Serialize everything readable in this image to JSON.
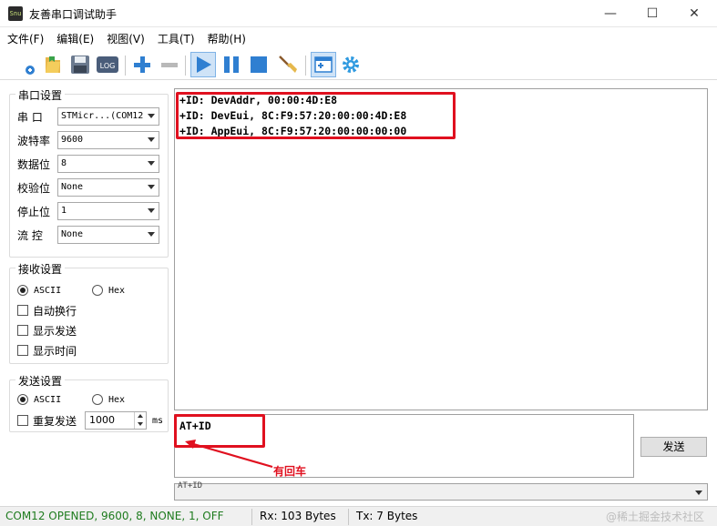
{
  "window": {
    "title": "友善串口调试助手",
    "app_icon_text": "Snu",
    "min": "—",
    "max": "☐",
    "close": "✕"
  },
  "menu": [
    "文件(F)",
    "编辑(E)",
    "视图(V)",
    "工具(T)",
    "帮助(H)"
  ],
  "toolbar": {
    "icons": [
      "new-icon",
      "open-icon",
      "save-icon",
      "log-icon",
      "add-icon",
      "remove-icon",
      "play-icon",
      "pause-icon",
      "stop-icon",
      "clear-icon",
      "window-icon",
      "settings-icon"
    ],
    "log_label": "LOG"
  },
  "serial_settings": {
    "title": "串口设置",
    "port_label": "串  口",
    "port_value": "STMicr...(COM12",
    "baud_label": "波特率",
    "baud_value": "9600",
    "databits_label": "数据位",
    "databits_value": "8",
    "parity_label": "校验位",
    "parity_value": "None",
    "stopbits_label": "停止位",
    "stopbits_value": "1",
    "flow_label": "流  控",
    "flow_value": "None"
  },
  "receive_settings": {
    "title": "接收设置",
    "ascii": "ASCII",
    "hex": "Hex",
    "auto_wrap": "自动换行",
    "show_send": "显示发送",
    "show_time": "显示时间"
  },
  "send_settings": {
    "title": "发送设置",
    "ascii": "ASCII",
    "hex": "Hex",
    "repeat": "重复发送",
    "interval": "1000",
    "unit": "ms"
  },
  "receive_lines": [
    "+ID: DevAddr, 00:00:4D:E8",
    "+ID: DevEui, 8C:F9:57:20:00:00:4D:E8",
    "+ID: AppEui, 8C:F9:57:20:00:00:00:00"
  ],
  "send_text": "AT+ID",
  "send_button": "发送",
  "history_text": "AT+ID",
  "annotation": "有回车",
  "status": {
    "conn": "COM12 OPENED, 9600, 8, NONE, 1, OFF",
    "rx": "Rx: 103 Bytes",
    "tx": "Tx: 7 Bytes",
    "watermark": "@稀土掘金技术社区"
  },
  "colors": {
    "conn_text": "#1e7b1e",
    "highlight": "#e0101f",
    "toolbar_blue": "#2f7fd1"
  }
}
